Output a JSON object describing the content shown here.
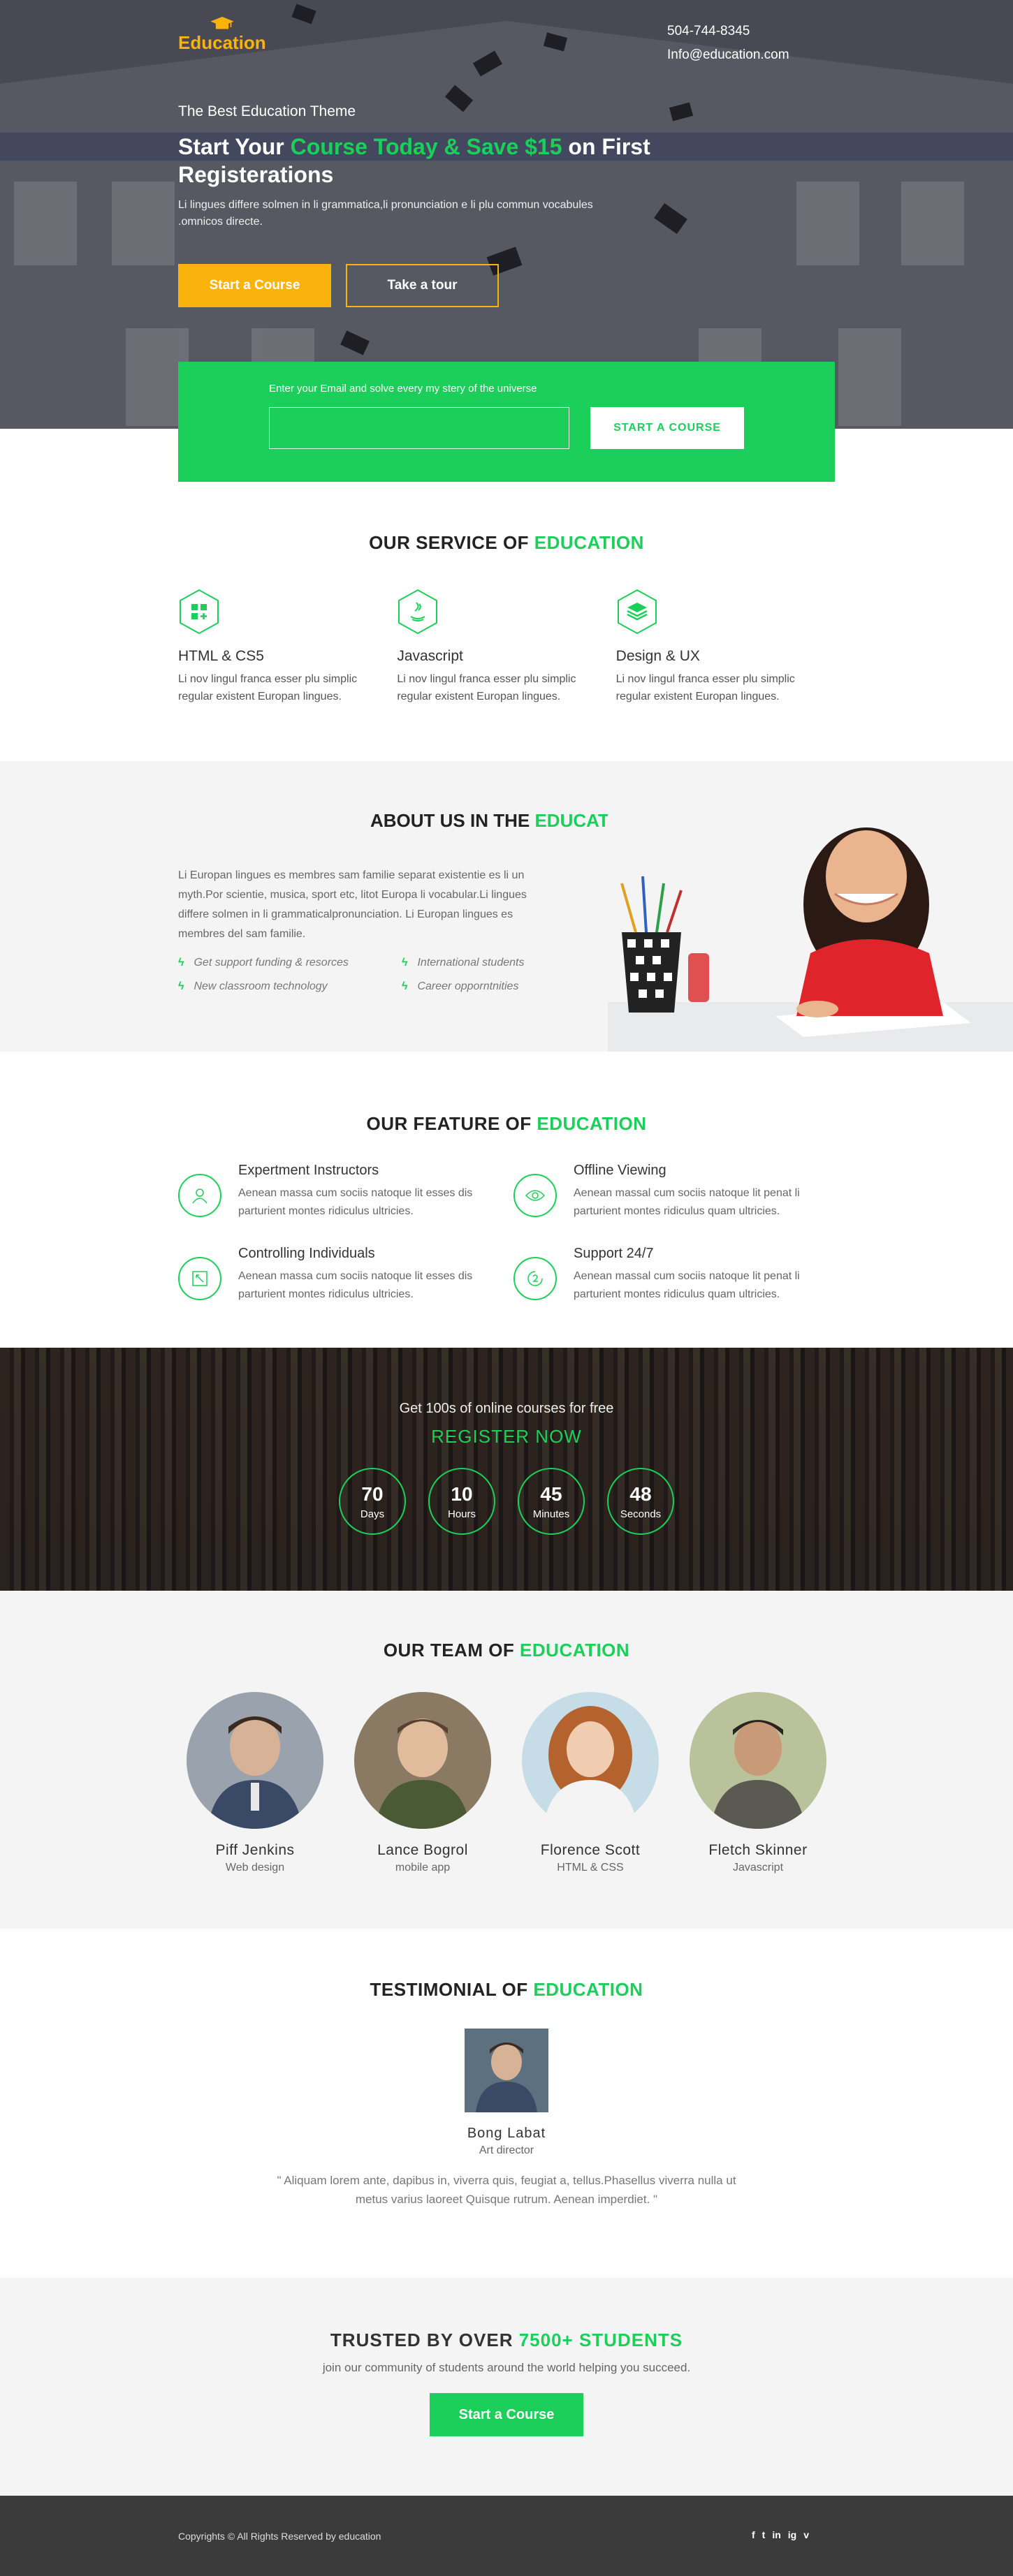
{
  "header": {
    "logo_text": "Education",
    "phone": "504-744-8345",
    "email": "Info@education.com"
  },
  "hero": {
    "tagline": "The Best Education Theme",
    "title_a": "Start Your ",
    "title_highlight": "Course Today & Save $15",
    "title_b": " on First Registerations",
    "description": "Li lingues differe solmen in li grammatica,li pronunciation e li plu commun vocabules .omnicos directe.",
    "btn_primary": "Start a Course",
    "btn_secondary": "Take a tour"
  },
  "signup": {
    "label": "Enter your Email and solve every my stery of the universe",
    "placeholder": "",
    "button": "START A COURSE"
  },
  "services": {
    "title_a": "OUR SERVICE OF ",
    "title_b": "EDUCATION",
    "items": [
      {
        "icon": "apps-icon",
        "title": "HTML & CS5",
        "desc": "Li nov lingul franca esser plu simplic regular existent Europan lingues."
      },
      {
        "icon": "java-icon",
        "title": "Javascript",
        "desc": "Li nov lingul franca esser plu simplic regular existent Europan lingues."
      },
      {
        "icon": "layers-icon",
        "title": "Design & UX",
        "desc": "Li nov lingul franca esser plu simplic regular existent Europan lingues."
      }
    ]
  },
  "about": {
    "title_a": "ABOUT US IN THE ",
    "title_b": "EDUCATION",
    "paragraph": "Li Europan lingues es membres sam familie separat existentie es li un myth.Por scientie, musica, sport etc, litot Europa li vocabular.Li lingues differe solmen in li grammaticalpronunciation. Li Europan lingues es membres del sam familie.",
    "features": [
      "Get support funding & resorces",
      "International students",
      "New classroom technology",
      "Career opporntnities"
    ]
  },
  "features": {
    "title_a": "OUR FEATURE OF ",
    "title_b": "EDUCATION",
    "items": [
      {
        "icon": "user-icon",
        "title": "Expertment Instructors",
        "desc": "Aenean massa cum sociis natoque lit esses dis parturient montes ridiculus ultricies."
      },
      {
        "icon": "eye-icon",
        "title": "Offline Viewing",
        "desc": "Aenean massal cum sociis natoque lit penat li parturient montes ridiculus quam ultricies."
      },
      {
        "icon": "resize-icon",
        "title": "Controlling Individuals",
        "desc": "Aenean massa cum sociis natoque lit esses dis parturient montes ridiculus ultricies."
      },
      {
        "icon": "support-icon",
        "title": "Support 24/7",
        "desc": "Aenean massal cum sociis natoque lit penat li parturient montes ridiculus quam ultricies."
      }
    ]
  },
  "countdown": {
    "subtitle": "Get 100s of online courses for free",
    "register": "REGISTER NOW",
    "timers": [
      {
        "value": "70",
        "label": "Days"
      },
      {
        "value": "10",
        "label": "Hours"
      },
      {
        "value": "45",
        "label": "Minutes"
      },
      {
        "value": "48",
        "label": "Seconds"
      }
    ]
  },
  "team": {
    "title_a": "OUR TEAM OF ",
    "title_b": "EDUCATION",
    "members": [
      {
        "name": "Piff Jenkins",
        "role": "Web design"
      },
      {
        "name": "Lance Bogrol",
        "role": "mobile app"
      },
      {
        "name": "Florence Scott",
        "role": "HTML & CSS"
      },
      {
        "name": "Fletch Skinner",
        "role": "Javascript"
      }
    ]
  },
  "testimonial": {
    "title_a": "TESTIMONIAL OF ",
    "title_b": "EDUCATION",
    "name": "Bong Labat",
    "role": "Art director",
    "quote": "\" Aliquam lorem ante, dapibus in, viverra quis, feugiat a, tellus.Phasellus viverra nulla ut metus varius laoreet Quisque rutrum. Aenean imperdiet. \""
  },
  "trust": {
    "title_a": "TRUSTED BY OVER ",
    "title_b": "7500+ STUDENTS",
    "subtitle": "join our community of students around the world helping you succeed.",
    "button": "Start a Course"
  },
  "footer": {
    "copyright": "Copyrights © All Rights Reserved by education",
    "social": [
      "f",
      "t",
      "in",
      "ig",
      "v"
    ]
  },
  "colors": {
    "accent": "#1ccf5a",
    "brand_yellow": "#f9b30c",
    "footer": "#3b3b3b"
  }
}
